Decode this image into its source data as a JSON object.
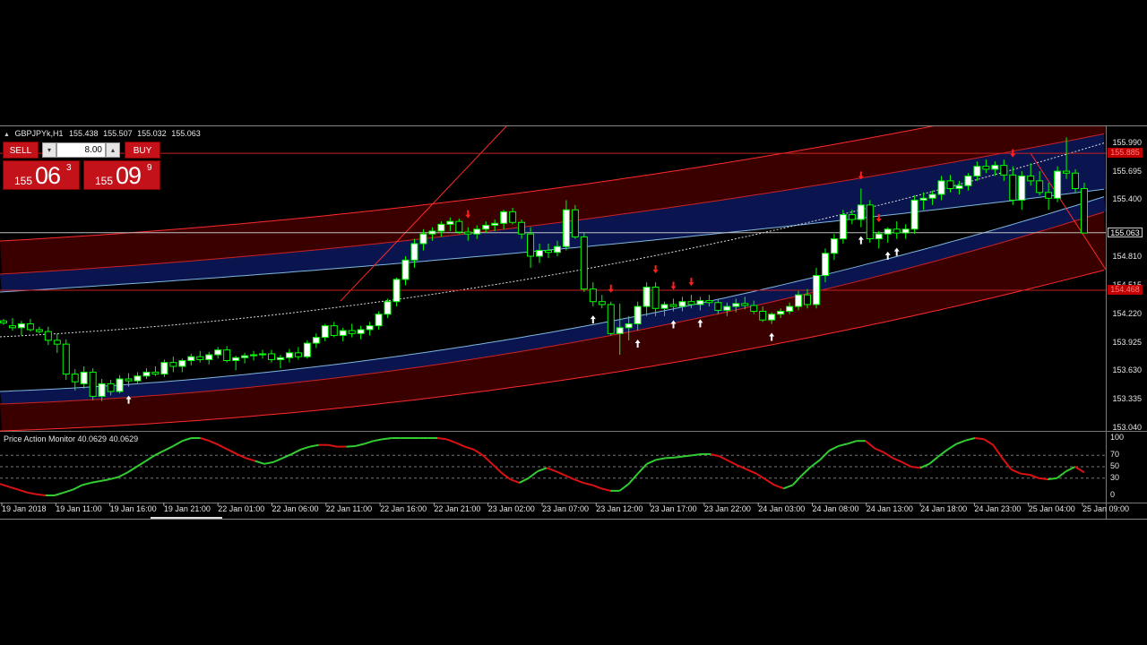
{
  "window": {
    "symbol": "GBPJPYk,H1",
    "open": "155.438",
    "high": "155.507",
    "low": "155.032",
    "close": "155.063"
  },
  "trade_panel": {
    "sell_label": "SELL",
    "buy_label": "BUY",
    "lot_value": "8.00",
    "sell_price": {
      "small": "155",
      "big": "06",
      "sup": "3"
    },
    "buy_price": {
      "small": "155",
      "big": "09",
      "sup": "9"
    }
  },
  "price_axis": {
    "labels": [
      "155.990",
      "155.695",
      "155.400",
      "154.810",
      "154.515",
      "154.220",
      "153.925",
      "153.630",
      "153.335",
      "153.040"
    ],
    "tag_top": "155.885",
    "tag_current": "155.063",
    "tag_low": "154.468"
  },
  "indicator": {
    "title": "Price Action Monitor 40.0629 40.0629",
    "levels": [
      "100",
      "70",
      "50",
      "30",
      "0"
    ]
  },
  "time_axis": [
    "19 Jan 2018",
    "19 Jan 11:00",
    "19 Jan 16:00",
    "19 Jan 21:00",
    "22 Jan 01:00",
    "22 Jan 06:00",
    "22 Jan 11:00",
    "22 Jan 16:00",
    "22 Jan 21:00",
    "23 Jan 02:00",
    "23 Jan 07:00",
    "23 Jan 12:00",
    "23 Jan 17:00",
    "23 Jan 22:00",
    "24 Jan 03:00",
    "24 Jan 08:00",
    "24 Jan 13:00",
    "24 Jan 18:00",
    "24 Jan 23:00",
    "25 Jan 04:00",
    "25 Jan 09:00"
  ],
  "colors": {
    "bull": "#ffffff",
    "bear": "#000000",
    "wick": "#00ff00",
    "channel_fill": "#3a0000",
    "blue_band": "#0a1550",
    "red_line": "#ff2a2a",
    "signal_up": "#ffffff",
    "signal_down": "#ff2020",
    "osc_up": "#33cc33",
    "osc_down": "#dd1111"
  },
  "chart_data": {
    "type": "candlestick",
    "timeframe": "H1",
    "candles": [
      [
        154.15,
        154.17,
        154.11,
        154.13
      ],
      [
        154.1,
        154.18,
        154.05,
        154.08
      ],
      [
        154.08,
        154.15,
        154.0,
        154.12
      ],
      [
        154.12,
        154.17,
        154.04,
        154.06
      ],
      [
        154.06,
        154.09,
        154.02,
        154.04
      ],
      [
        154.04,
        154.09,
        153.9,
        153.95
      ],
      [
        153.95,
        154.02,
        153.82,
        153.91
      ],
      [
        153.91,
        153.96,
        153.54,
        153.6
      ],
      [
        153.6,
        153.65,
        153.43,
        153.52
      ],
      [
        153.5,
        153.68,
        153.45,
        153.62
      ],
      [
        153.62,
        153.66,
        153.33,
        153.37
      ],
      [
        153.37,
        153.55,
        153.32,
        153.5
      ],
      [
        153.5,
        153.54,
        153.38,
        153.42
      ],
      [
        153.42,
        153.59,
        153.4,
        153.55
      ],
      [
        153.55,
        153.61,
        153.47,
        153.53
      ],
      [
        153.53,
        153.62,
        153.5,
        153.58
      ],
      [
        153.58,
        153.66,
        153.55,
        153.62
      ],
      [
        153.62,
        153.68,
        153.58,
        153.6
      ],
      [
        153.6,
        153.75,
        153.57,
        153.72
      ],
      [
        153.72,
        153.78,
        153.62,
        153.68
      ],
      [
        153.68,
        153.76,
        153.62,
        153.74
      ],
      [
        153.74,
        153.81,
        153.69,
        153.78
      ],
      [
        153.78,
        153.84,
        153.72,
        153.75
      ],
      [
        153.75,
        153.83,
        153.7,
        153.8
      ],
      [
        153.8,
        153.88,
        153.76,
        153.85
      ],
      [
        153.85,
        153.89,
        153.72,
        153.74
      ],
      [
        153.74,
        153.79,
        153.64,
        153.77
      ],
      [
        153.77,
        153.82,
        153.71,
        153.79
      ],
      [
        153.79,
        153.84,
        153.74,
        153.8
      ],
      [
        153.8,
        153.85,
        153.76,
        153.81
      ],
      [
        153.81,
        153.85,
        153.72,
        153.75
      ],
      [
        153.75,
        153.8,
        153.66,
        153.77
      ],
      [
        153.77,
        153.86,
        153.72,
        153.82
      ],
      [
        153.82,
        153.88,
        153.75,
        153.78
      ],
      [
        153.78,
        153.95,
        153.76,
        153.92
      ],
      [
        153.92,
        154.02,
        153.87,
        153.98
      ],
      [
        153.98,
        154.12,
        153.94,
        154.1
      ],
      [
        154.1,
        154.14,
        153.98,
        154.0
      ],
      [
        154.0,
        154.08,
        153.94,
        154.05
      ],
      [
        154.05,
        154.12,
        153.98,
        154.02
      ],
      [
        154.02,
        154.1,
        153.96,
        154.06
      ],
      [
        154.06,
        154.14,
        154.0,
        154.1
      ],
      [
        154.1,
        154.25,
        154.06,
        154.22
      ],
      [
        154.22,
        154.38,
        154.18,
        154.35
      ],
      [
        154.35,
        154.6,
        154.3,
        154.58
      ],
      [
        154.58,
        154.82,
        154.52,
        154.78
      ],
      [
        154.78,
        155.0,
        154.7,
        154.95
      ],
      [
        154.95,
        155.1,
        154.88,
        155.05
      ],
      [
        155.05,
        155.12,
        154.98,
        155.08
      ],
      [
        155.08,
        155.18,
        155.02,
        155.15
      ],
      [
        155.15,
        155.22,
        155.08,
        155.18
      ],
      [
        155.18,
        155.21,
        155.05,
        155.07
      ],
      [
        155.07,
        155.12,
        154.98,
        155.05
      ],
      [
        155.05,
        155.14,
        155.0,
        155.1
      ],
      [
        155.1,
        155.18,
        155.06,
        155.14
      ],
      [
        155.14,
        155.2,
        155.08,
        155.16
      ],
      [
        155.16,
        155.3,
        155.1,
        155.28
      ],
      [
        155.28,
        155.32,
        155.15,
        155.17
      ],
      [
        155.17,
        155.2,
        155.0,
        155.05
      ],
      [
        155.05,
        155.12,
        154.7,
        154.82
      ],
      [
        154.82,
        154.95,
        154.75,
        154.88
      ],
      [
        154.88,
        154.95,
        154.8,
        154.86
      ],
      [
        154.86,
        154.98,
        154.82,
        154.92
      ],
      [
        154.92,
        155.4,
        154.88,
        155.3
      ],
      [
        155.3,
        155.35,
        155.0,
        155.02
      ],
      [
        155.02,
        155.06,
        154.45,
        154.48
      ],
      [
        154.48,
        154.55,
        154.3,
        154.35
      ],
      [
        154.35,
        154.42,
        154.28,
        154.32
      ],
      [
        154.32,
        154.35,
        154.0,
        154.02
      ],
      [
        154.02,
        154.33,
        153.8,
        154.08
      ],
      [
        154.08,
        154.2,
        153.95,
        154.12
      ],
      [
        154.12,
        154.35,
        154.05,
        154.3
      ],
      [
        154.3,
        154.55,
        154.2,
        154.5
      ],
      [
        154.5,
        154.55,
        154.2,
        154.28
      ],
      [
        154.28,
        154.35,
        154.2,
        154.32
      ],
      [
        154.32,
        154.38,
        154.25,
        154.3
      ],
      [
        154.3,
        154.4,
        154.25,
        154.35
      ],
      [
        154.35,
        154.42,
        154.28,
        154.32
      ],
      [
        154.32,
        154.4,
        154.26,
        154.36
      ],
      [
        154.36,
        154.42,
        154.3,
        154.34
      ],
      [
        154.34,
        154.38,
        154.22,
        154.26
      ],
      [
        154.26,
        154.34,
        154.2,
        154.3
      ],
      [
        154.3,
        154.38,
        154.24,
        154.33
      ],
      [
        154.33,
        154.4,
        154.27,
        154.31
      ],
      [
        154.31,
        154.36,
        154.22,
        154.25
      ],
      [
        154.25,
        154.3,
        154.14,
        154.16
      ],
      [
        154.16,
        154.24,
        154.12,
        154.22
      ],
      [
        154.22,
        154.28,
        154.18,
        154.25
      ],
      [
        154.25,
        154.34,
        154.22,
        154.3
      ],
      [
        154.3,
        154.46,
        154.26,
        154.42
      ],
      [
        154.42,
        154.48,
        154.28,
        154.32
      ],
      [
        154.32,
        154.7,
        154.28,
        154.62
      ],
      [
        154.62,
        154.9,
        154.55,
        154.85
      ],
      [
        154.85,
        155.05,
        154.78,
        155.0
      ],
      [
        155.0,
        155.3,
        154.95,
        155.25
      ],
      [
        155.25,
        155.3,
        155.15,
        155.2
      ],
      [
        155.2,
        155.52,
        155.12,
        155.35
      ],
      [
        155.35,
        155.4,
        154.96,
        155.0
      ],
      [
        155.0,
        155.08,
        154.9,
        155.05
      ],
      [
        155.05,
        155.12,
        154.96,
        155.1
      ],
      [
        155.1,
        155.18,
        155.0,
        155.06
      ],
      [
        155.06,
        155.15,
        155.0,
        155.1
      ],
      [
        155.1,
        155.45,
        155.05,
        155.4
      ],
      [
        155.4,
        155.48,
        155.3,
        155.42
      ],
      [
        155.42,
        155.5,
        155.35,
        155.46
      ],
      [
        155.46,
        155.65,
        155.4,
        155.6
      ],
      [
        155.6,
        155.66,
        155.48,
        155.52
      ],
      [
        155.52,
        155.6,
        155.46,
        155.55
      ],
      [
        155.55,
        155.68,
        155.5,
        155.65
      ],
      [
        155.65,
        155.8,
        155.6,
        155.75
      ],
      [
        155.75,
        155.82,
        155.68,
        155.72
      ],
      [
        155.72,
        155.8,
        155.65,
        155.76
      ],
      [
        155.76,
        155.82,
        155.6,
        155.66
      ],
      [
        155.66,
        155.75,
        155.35,
        155.4
      ],
      [
        155.4,
        155.7,
        155.3,
        155.65
      ],
      [
        155.65,
        155.78,
        155.55,
        155.6
      ],
      [
        155.6,
        155.7,
        155.45,
        155.48
      ],
      [
        155.48,
        155.58,
        155.3,
        155.42
      ],
      [
        155.42,
        155.75,
        155.38,
        155.7
      ],
      [
        155.7,
        156.05,
        155.62,
        155.68
      ],
      [
        155.68,
        155.72,
        155.48,
        155.52
      ],
      [
        155.52,
        155.58,
        155.1,
        155.06
      ]
    ],
    "price_range": [
      153.04,
      156.09
    ],
    "price_ticks": [
      155.99,
      155.695,
      155.4,
      154.81,
      154.515,
      154.22,
      153.925,
      153.63,
      153.335,
      153.04
    ],
    "horizontal_lines": [
      155.885,
      155.063,
      154.468
    ],
    "signals_up": [
      14,
      66,
      71,
      75,
      78,
      86,
      96,
      99,
      100
    ],
    "signals_down": [
      52,
      68,
      73,
      75,
      77,
      96,
      98,
      113
    ],
    "oscillator": {
      "name": "Price Action Monitor",
      "range": [
        0,
        100
      ],
      "levels": [
        70,
        50,
        30
      ],
      "values": [
        20,
        15,
        10,
        5,
        2,
        0,
        0,
        5,
        10,
        18,
        22,
        25,
        28,
        32,
        40,
        50,
        60,
        70,
        78,
        86,
        95,
        100,
        100,
        95,
        88,
        80,
        72,
        65,
        60,
        55,
        58,
        65,
        72,
        80,
        85,
        88,
        88,
        85,
        85,
        86,
        90,
        95,
        98,
        100,
        100,
        100,
        100,
        100,
        100,
        98,
        92,
        85,
        80,
        70,
        55,
        40,
        28,
        22,
        30,
        42,
        48,
        42,
        35,
        28,
        22,
        18,
        12,
        8,
        8,
        20,
        38,
        55,
        62,
        65,
        66,
        68,
        70,
        72,
        72,
        68,
        60,
        52,
        45,
        38,
        28,
        18,
        12,
        18,
        35,
        50,
        62,
        78,
        86,
        90,
        95,
        95,
        82,
        75,
        65,
        58,
        50,
        48,
        55,
        68,
        80,
        90,
        96,
        100,
        98,
        88,
        65,
        45,
        38,
        36,
        30,
        28,
        30,
        42,
        50,
        40
      ],
      "direction": [
        "down",
        "down",
        "down",
        "down",
        "down",
        "down",
        "up",
        "up",
        "up",
        "up",
        "up",
        "up",
        "up",
        "up",
        "up",
        "up",
        "up",
        "up",
        "up",
        "up",
        "up",
        "up",
        "up",
        "down",
        "down",
        "down",
        "down",
        "down",
        "down",
        "up",
        "up",
        "up",
        "up",
        "up",
        "up",
        "up",
        "down",
        "down",
        "down",
        "up",
        "up",
        "up",
        "up",
        "up",
        "up",
        "up",
        "up",
        "up",
        "up",
        "down",
        "down",
        "down",
        "down",
        "down",
        "down",
        "down",
        "down",
        "down",
        "up",
        "up",
        "up",
        "down",
        "down",
        "down",
        "down",
        "down",
        "down",
        "down",
        "up",
        "up",
        "up",
        "up",
        "up",
        "up",
        "up",
        "up",
        "up",
        "up",
        "up",
        "down",
        "down",
        "down",
        "down",
        "down",
        "down",
        "down",
        "down",
        "up",
        "up",
        "up",
        "up",
        "up",
        "up",
        "up",
        "up",
        "up",
        "down",
        "down",
        "down",
        "down",
        "down",
        "down",
        "up",
        "up",
        "up",
        "up",
        "up",
        "up",
        "down",
        "down",
        "down",
        "down",
        "down",
        "down",
        "down",
        "down",
        "up",
        "up",
        "up",
        "down"
      ]
    }
  }
}
